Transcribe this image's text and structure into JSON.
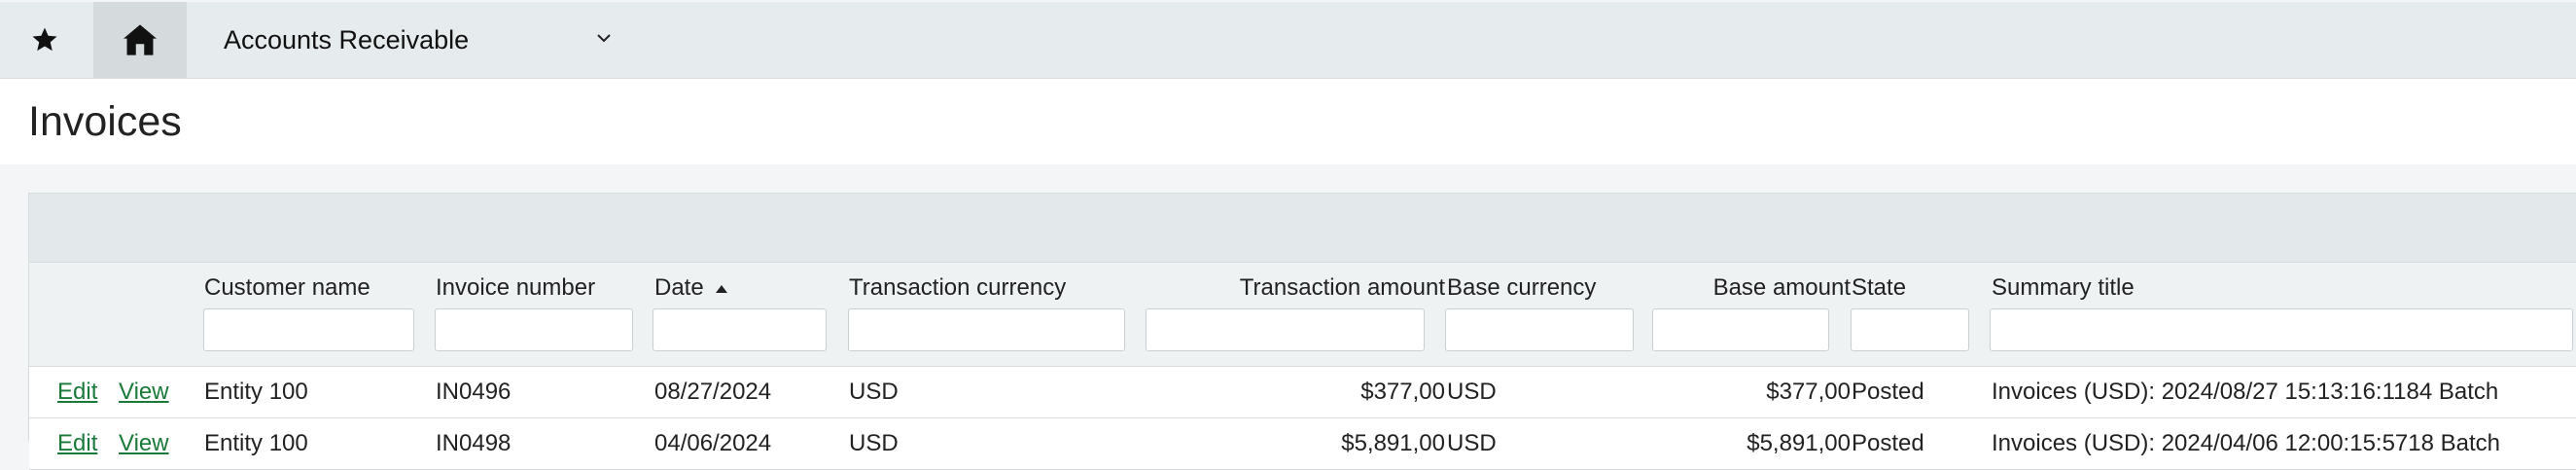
{
  "topbar": {
    "favorite_icon": "star-icon",
    "home_icon": "home-icon",
    "module_label": "Accounts Receivable",
    "module_chevron_icon": "chevron-down-icon"
  },
  "page": {
    "title": "Invoices"
  },
  "table": {
    "columns": [
      {
        "key": "customer_name",
        "label": "Customer name"
      },
      {
        "key": "invoice_number",
        "label": "Invoice number"
      },
      {
        "key": "date",
        "label": "Date",
        "sort": "ascending"
      },
      {
        "key": "transaction_currency",
        "label": "Transaction currency"
      },
      {
        "key": "transaction_amount",
        "label": "Transaction amount"
      },
      {
        "key": "base_currency",
        "label": "Base currency"
      },
      {
        "key": "base_amount",
        "label": "Base amount"
      },
      {
        "key": "state",
        "label": "State"
      },
      {
        "key": "summary_title",
        "label": "Summary title"
      }
    ],
    "row_actions": {
      "edit": "Edit",
      "view": "View"
    },
    "rows": [
      {
        "customer_name": "Entity 100",
        "invoice_number": "IN0496",
        "date": "08/27/2024",
        "transaction_currency": "USD",
        "transaction_amount": "$377,00",
        "base_currency": "USD",
        "base_amount": "$377,00",
        "state": "Posted",
        "summary_title": "Invoices (USD): 2024/08/27 15:13:16:1184 Batch"
      },
      {
        "customer_name": "Entity 100",
        "invoice_number": "IN0498",
        "date": "04/06/2024",
        "transaction_currency": "USD",
        "transaction_amount": "$5,891,00",
        "base_currency": "USD",
        "base_amount": "$5,891,00",
        "state": "Posted",
        "summary_title": "Invoices (USD): 2024/04/06 12:00:15:5718 Batch"
      }
    ]
  }
}
